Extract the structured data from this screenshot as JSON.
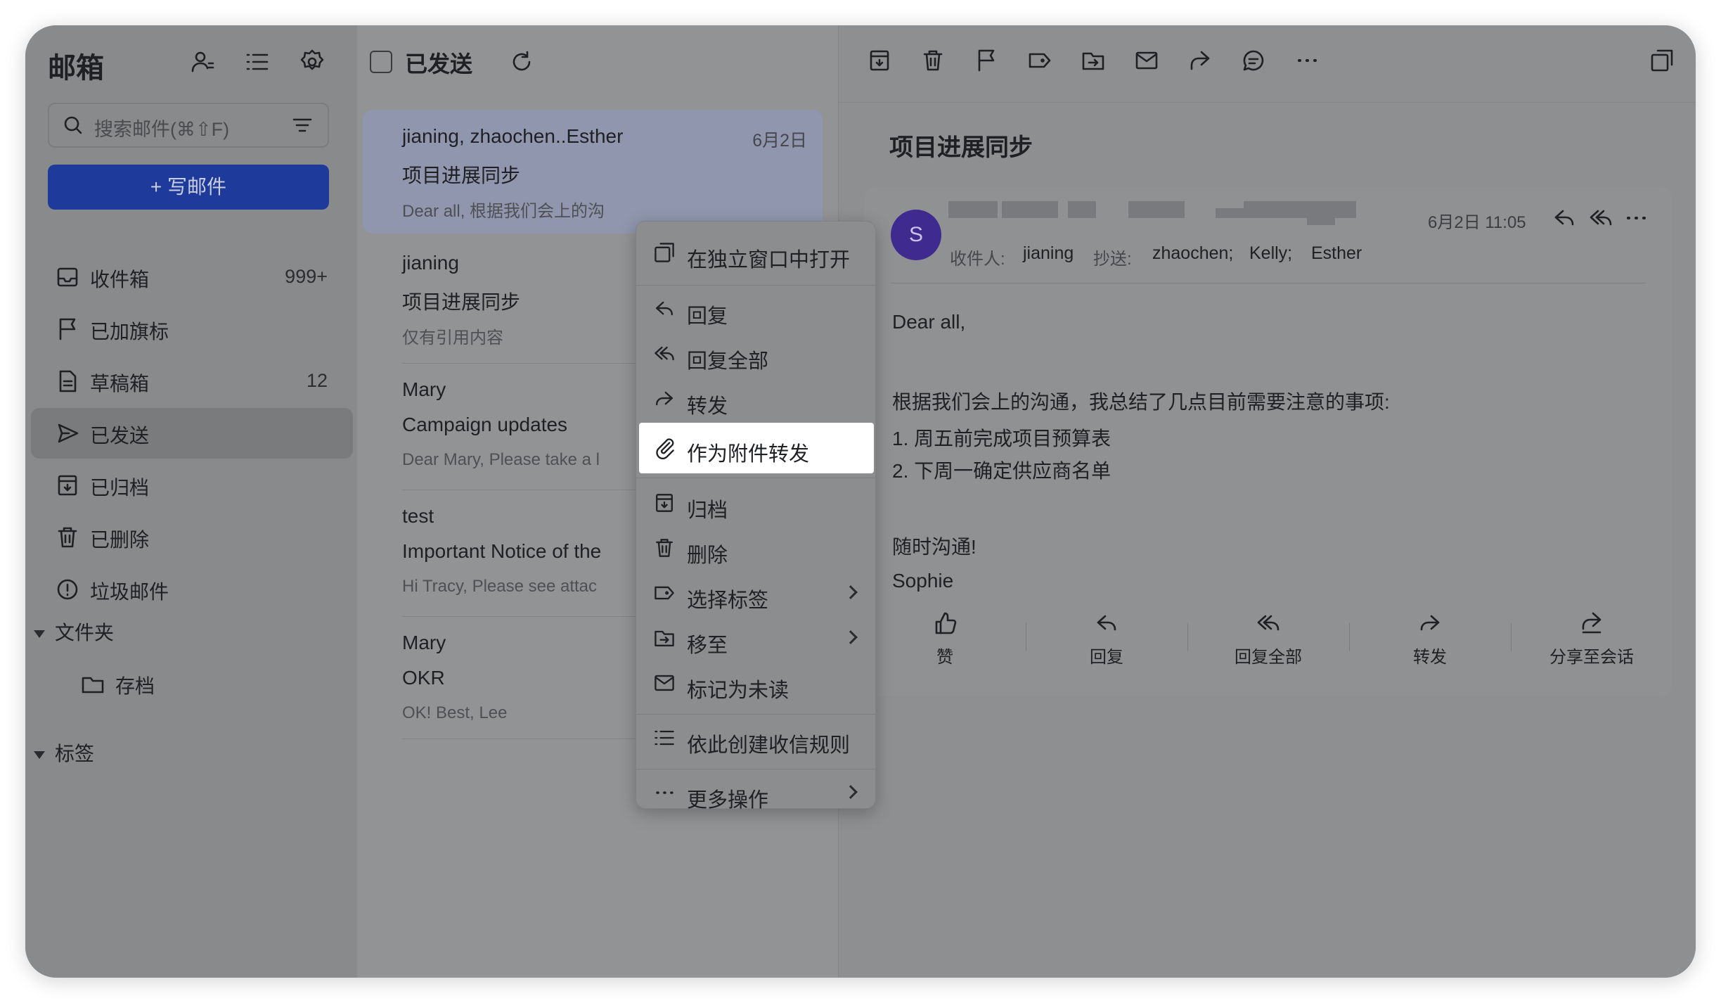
{
  "sidebar": {
    "title": "邮箱",
    "search_placeholder": "搜索邮件(⌘⇧F)",
    "compose_label": "+ 写邮件",
    "items": [
      {
        "label": "收件箱",
        "count": "999+"
      },
      {
        "label": "已加旗标",
        "count": ""
      },
      {
        "label": "草稿箱",
        "count": "12"
      },
      {
        "label": "已发送",
        "count": ""
      },
      {
        "label": "已归档",
        "count": ""
      },
      {
        "label": "已删除",
        "count": ""
      },
      {
        "label": "垃圾邮件",
        "count": ""
      }
    ],
    "folders_label": "文件夹",
    "folder_items": [
      {
        "label": "存档"
      }
    ],
    "tags_label": "标签"
  },
  "list": {
    "header_title": "已发送",
    "mails": [
      {
        "from": "jianing, zhaochen..Esther",
        "date": "6月2日",
        "subject": "项目进展同步",
        "preview": "Dear all, 根据我们会上的沟"
      },
      {
        "from": "jianing",
        "date": "",
        "subject": "项目进展同步",
        "preview": "仅有引用内容"
      },
      {
        "from": "Mary",
        "date": "",
        "subject": "Campaign updates",
        "preview": "Dear Mary, Please take a l"
      },
      {
        "from": "test",
        "date": "",
        "subject": "Important Notice of the",
        "preview": "Hi Tracy, Please see attac"
      },
      {
        "from": "Mary",
        "date": "",
        "subject": "OKR",
        "preview": "OK! Best, Lee"
      }
    ]
  },
  "context_menu": {
    "items": [
      {
        "label": "在独立窗口中打开",
        "icon": "open-window-icon"
      },
      {
        "label": "回复",
        "icon": "reply-icon"
      },
      {
        "label": "回复全部",
        "icon": "reply-all-icon"
      },
      {
        "label": "转发",
        "icon": "forward-icon"
      },
      {
        "label": "作为附件转发",
        "icon": "attachment-icon"
      },
      {
        "label": "归档",
        "icon": "archive-icon"
      },
      {
        "label": "删除",
        "icon": "trash-icon"
      },
      {
        "label": "选择标签",
        "icon": "tag-icon"
      },
      {
        "label": "移至",
        "icon": "move-icon"
      },
      {
        "label": "标记为未读",
        "icon": "mail-unread-icon"
      },
      {
        "label": "依此创建收信规则",
        "icon": "rule-list-icon"
      },
      {
        "label": "更多操作",
        "icon": "more-icon"
      }
    ]
  },
  "reader": {
    "subject": "项目进展同步",
    "avatar_letter": "S",
    "datetime": "6月2日 11:05",
    "to_label": "收件人:",
    "to": "jianing",
    "cc_label": "抄送:",
    "cc": [
      "zhaochen;",
      "Kelly;",
      "Esther"
    ],
    "body": {
      "greeting": "Dear all,",
      "intro": "根据我们会上的沟通，我总结了几点目前需要注意的事项:",
      "point1": "1. 周五前完成项目预算表",
      "point2": "2.  下周一确定供应商名单",
      "closing": "随时沟通!",
      "signature": "Sophie"
    },
    "actions": {
      "like": "赞",
      "reply": "回复",
      "reply_all": "回复全部",
      "forward": "转发",
      "share": "分享至会话"
    }
  },
  "colors": {
    "accent": "#1e3a9a",
    "avatar": "#3f2a8f",
    "highlight": "#ffffff"
  }
}
